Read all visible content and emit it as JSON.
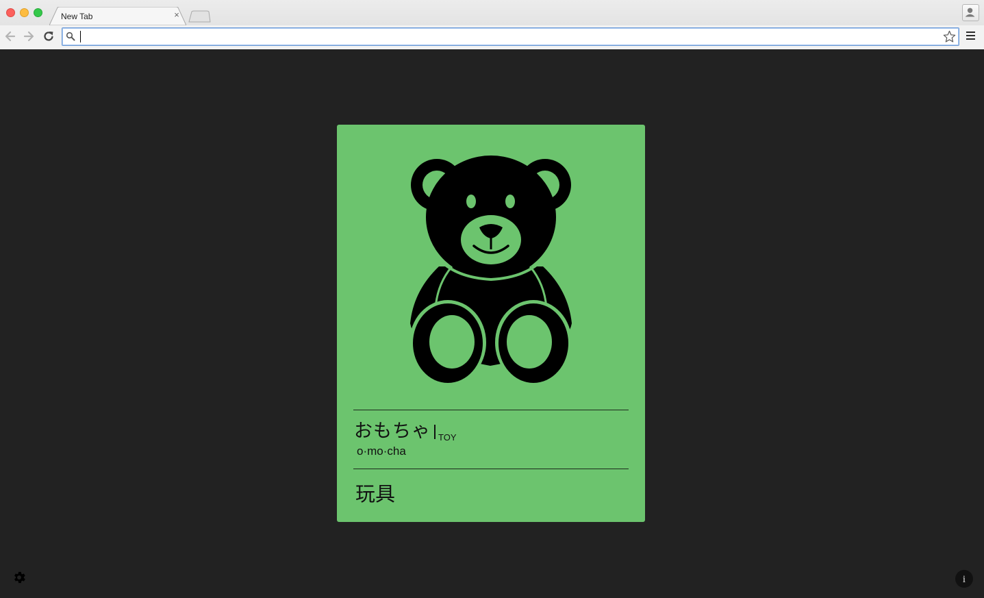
{
  "browser": {
    "tab_title": "New Tab",
    "tab_close_glyph": "×",
    "address_value": "",
    "icons": [
      "back-arrow-icon",
      "forward-arrow-icon",
      "reload-icon",
      "search-icon",
      "bookmark-star-icon",
      "hamburger-menu-icon",
      "profile-icon"
    ]
  },
  "card": {
    "background": "#6cc46e",
    "image": "teddy-bear-icon",
    "word_japanese": "おもちゃ",
    "word_english": "TOY",
    "romaji": "o·mo·cha",
    "kanji": "玩具"
  },
  "footer": {
    "settings_icon": "gear-icon",
    "info_label": "i"
  }
}
